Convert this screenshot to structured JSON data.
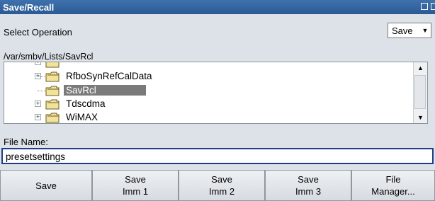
{
  "window": {
    "title": "Save/Recall"
  },
  "operation": {
    "label": "Select Operation",
    "value": "Save"
  },
  "path": "/var/smbv/Lists/SavRcl",
  "tree": {
    "items": [
      {
        "label": "RfboSynRefCalData",
        "expandable": true,
        "selected": false
      },
      {
        "label": "SavRcl",
        "expandable": false,
        "selected": true
      },
      {
        "label": "Tdscdma",
        "expandable": true,
        "selected": false
      },
      {
        "label": "WiMAX",
        "expandable": true,
        "selected": false
      }
    ]
  },
  "file_name": {
    "label": "File Name:",
    "value": "presetsettings"
  },
  "buttons": {
    "save": {
      "line1": "Save"
    },
    "save_imm1": {
      "line1": "Save",
      "line2": "Imm 1"
    },
    "save_imm2": {
      "line1": "Save",
      "line2": "Imm 2"
    },
    "save_imm3": {
      "line1": "Save",
      "line2": "Imm 3"
    },
    "file_manager": {
      "line1": "File",
      "line2": "Manager..."
    }
  },
  "colors": {
    "titlebar": "#2f63a0",
    "selection": "#7a7a7a",
    "input_border": "#1e3f86"
  }
}
